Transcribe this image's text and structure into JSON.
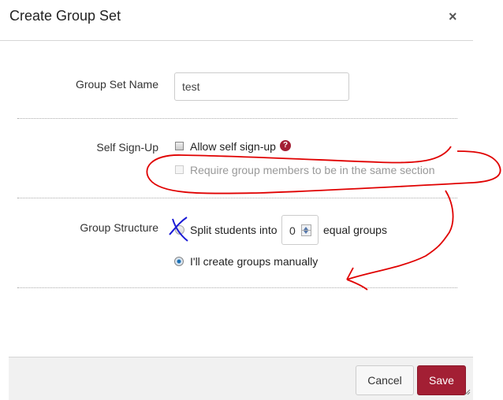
{
  "dialog": {
    "title": "Create Group Set",
    "close_icon": "close-icon"
  },
  "group_set_name": {
    "label": "Group Set Name",
    "value": "test"
  },
  "self_signup": {
    "label": "Self Sign-Up",
    "allow_label": "Allow self sign-up",
    "allow_checked": false,
    "help_icon": "help-icon",
    "help_glyph": "?",
    "require_label": "Require group members to be in the same section",
    "require_checked": false,
    "require_disabled": true
  },
  "group_structure": {
    "label": "Group Structure",
    "split_prefix": "Split students into",
    "split_count": "0",
    "split_suffix": "equal groups",
    "manual_label": "I'll create groups manually",
    "selected": "manual"
  },
  "footer": {
    "cancel_label": "Cancel",
    "save_label": "Save"
  },
  "colors": {
    "accent": "#a31f34",
    "annotation_red": "#e00000",
    "annotation_blue": "#1a1ad6"
  }
}
